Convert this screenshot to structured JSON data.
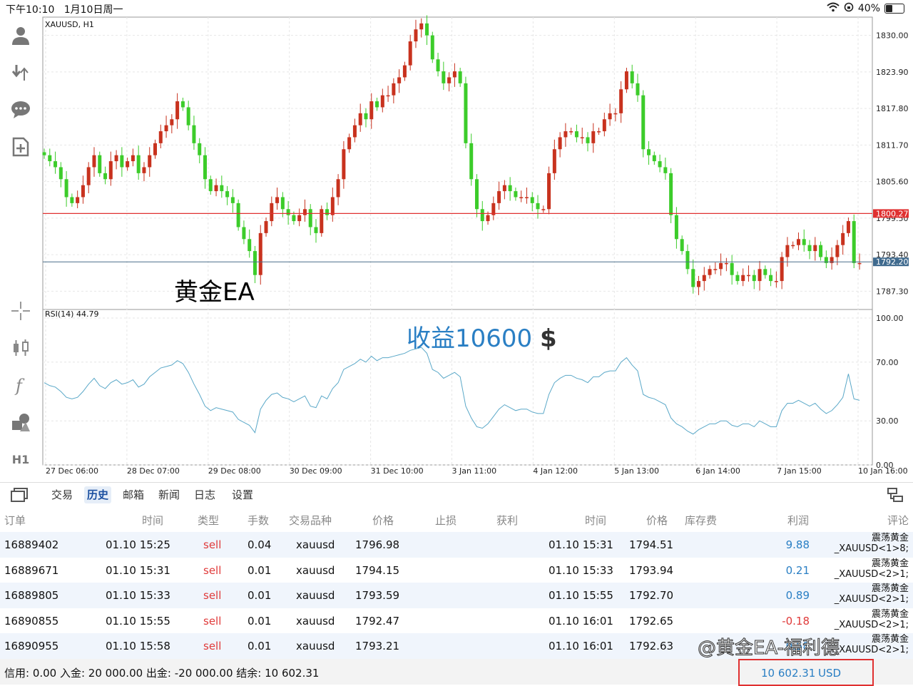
{
  "status": {
    "time": "下午10:10",
    "date": "1月10日周一",
    "battery": "40%",
    "battery_level": 0.4
  },
  "chart": {
    "symbol": "XAUUSD, H1",
    "price_ticks": [
      "1830.00",
      "1823.90",
      "1817.80",
      "1811.70",
      "1805.60",
      "1799.50",
      "1793.40",
      "1787.30"
    ],
    "red_line_label": "1800.27",
    "blue_line_label": "1792.20",
    "rsi_label": "RSI(14) 44.79",
    "rsi_ticks": [
      "100.00",
      "70.00",
      "30.00",
      "0.00"
    ],
    "time_ticks": [
      "27 Dec 06:00",
      "28 Dec 07:00",
      "29 Dec 08:00",
      "30 Dec 09:00",
      "31 Dec 10:00",
      "3 Jan 11:00",
      "4 Jan 12:00",
      "5 Jan 13:00",
      "6 Jan 14:00",
      "7 Jan 15:00",
      "10 Jan 16:00"
    ],
    "up_color": "#c8321e",
    "down_color": "#3ccc2a",
    "rsi_color": "#5aa8c8",
    "closes": [
      1810,
      1809,
      1808,
      1806,
      1803,
      1802,
      1803,
      1805,
      1808,
      1810,
      1807,
      1806,
      1809,
      1810,
      1808,
      1809,
      1810,
      1807,
      1808,
      1810,
      1812,
      1814,
      1815,
      1816,
      1819,
      1818,
      1815,
      1812,
      1810,
      1806,
      1804,
      1805,
      1804,
      1803,
      1802,
      1798,
      1796,
      1794,
      1790,
      1797,
      1799,
      1802,
      1803,
      1801,
      1800,
      1799,
      1800,
      1801,
      1798,
      1797,
      1801,
      1800,
      1803,
      1806,
      1811,
      1813,
      1815,
      1817,
      1816,
      1819,
      1818,
      1820,
      1820,
      1822,
      1823,
      1825,
      1829,
      1831,
      1832,
      1830,
      1826,
      1824,
      1822,
      1823,
      1824,
      1822,
      1812,
      1806,
      1801,
      1799,
      1800,
      1802,
      1804,
      1805,
      1804,
      1803,
      1803,
      1803,
      1802,
      1801,
      1801,
      1807,
      1811,
      1813,
      1814,
      1814,
      1813,
      1813,
      1812,
      1814,
      1814,
      1816,
      1817,
      1817,
      1821,
      1824,
      1822,
      1820,
      1811,
      1810,
      1809,
      1808,
      1807,
      1800,
      1796,
      1794,
      1791,
      1788,
      1789,
      1790,
      1791,
      1791,
      1792,
      1792,
      1790,
      1789,
      1790,
      1790,
      1789,
      1791,
      1790,
      1789,
      1789,
      1793,
      1795,
      1795,
      1796,
      1795,
      1794,
      1795,
      1793,
      1792,
      1793,
      1795,
      1797,
      1799,
      1792,
      1792
    ],
    "rsi": [
      56,
      54,
      53,
      50,
      46,
      45,
      46,
      50,
      55,
      59,
      54,
      52,
      56,
      58,
      55,
      56,
      58,
      53,
      55,
      60,
      63,
      66,
      67,
      68,
      71,
      69,
      63,
      55,
      48,
      40,
      37,
      39,
      38,
      37,
      36,
      31,
      29,
      27,
      22,
      38,
      44,
      48,
      49,
      46,
      45,
      43,
      45,
      47,
      40,
      39,
      47,
      45,
      52,
      56,
      65,
      67,
      69,
      72,
      70,
      74,
      71,
      73,
      73,
      74,
      75,
      76,
      78,
      79,
      80,
      76,
      65,
      63,
      59,
      61,
      63,
      60,
      40,
      32,
      26,
      25,
      28,
      33,
      38,
      41,
      39,
      37,
      38,
      38,
      36,
      35,
      35,
      48,
      56,
      59,
      61,
      61,
      59,
      58,
      56,
      60,
      60,
      63,
      64,
      64,
      70,
      73,
      68,
      64,
      48,
      46,
      45,
      43,
      41,
      32,
      28,
      26,
      23,
      21,
      24,
      26,
      28,
      28,
      30,
      30,
      27,
      26,
      28,
      28,
      26,
      30,
      28,
      26,
      26,
      37,
      42,
      42,
      44,
      42,
      40,
      42,
      38,
      35,
      37,
      41,
      46,
      62,
      45,
      44
    ]
  },
  "overlay": {
    "ea_text": "黄金EA",
    "profit_text": "收益10600",
    "currency_sym": "$"
  },
  "tabs": [
    "交易",
    "历史",
    "邮箱",
    "新闻",
    "日志",
    "设置"
  ],
  "active_tab": "历史",
  "columns": [
    "订单",
    "时间",
    "类型",
    "手数",
    "交易品种",
    "价格",
    "止损",
    "获利",
    "时间",
    "价格",
    "库存费",
    "利润",
    "评论"
  ],
  "rows": [
    {
      "order": "16889402",
      "open_time": "01.10 15:25",
      "type": "sell",
      "lots": "0.04",
      "symbol": "xauusd",
      "open_price": "1796.98",
      "close_time": "01.10 15:31",
      "close_price": "1794.51",
      "profit": "9.88",
      "c1": "震荡黄金",
      "c2": "_XAUUSD<1>8;"
    },
    {
      "order": "16889671",
      "open_time": "01.10 15:31",
      "type": "sell",
      "lots": "0.01",
      "symbol": "xauusd",
      "open_price": "1794.15",
      "close_time": "01.10 15:33",
      "close_price": "1793.94",
      "profit": "0.21",
      "c1": "震荡黄金",
      "c2": "_XAUUSD<2>1;"
    },
    {
      "order": "16889805",
      "open_time": "01.10 15:33",
      "type": "sell",
      "lots": "0.01",
      "symbol": "xauusd",
      "open_price": "1793.59",
      "close_time": "01.10 15:55",
      "close_price": "1792.70",
      "profit": "0.89",
      "c1": "震荡黄金",
      "c2": "_XAUUSD<2>1;"
    },
    {
      "order": "16890855",
      "open_time": "01.10 15:55",
      "type": "sell",
      "lots": "0.01",
      "symbol": "xauusd",
      "open_price": "1792.47",
      "close_time": "01.10 16:01",
      "close_price": "1792.65",
      "profit": "-0.18",
      "c1": "震荡黄金",
      "c2": "_XAUUSD<2>1;"
    },
    {
      "order": "16890955",
      "open_time": "01.10 15:58",
      "type": "sell",
      "lots": "0.01",
      "symbol": "xauusd",
      "open_price": "1793.21",
      "close_time": "01.10 16:01",
      "close_price": "1792.63",
      "profit": "0.58",
      "c1": "震荡黄金",
      "c2": "_XAUUSD<2>1;"
    }
  ],
  "footer": {
    "summary": "信用:  0.00 入金:  20 000.00 出金:  -20 000.00 结余:  10 602.31",
    "balance": "10 602.31",
    "currency": "USD"
  },
  "watermark": "@黄金EA-福利德"
}
